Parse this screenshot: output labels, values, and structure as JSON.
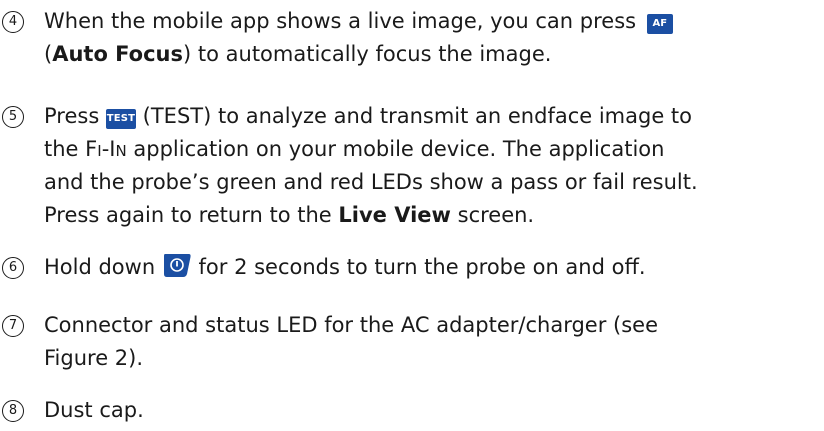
{
  "items": [
    {
      "number": "4",
      "line1_before": "When the mobile app shows a live image, you can press",
      "line1_icon": "AF",
      "line2_bold": "Auto Focus",
      "line2_open": "(",
      "line2_after": ") to automatically focus the image."
    },
    {
      "number": "5",
      "line1_before": "Press",
      "line1_icon": "TEST",
      "line1_after": "(TEST) to analyze and transmit an endface image to",
      "line2_before": "the",
      "line2_fi_F": "F",
      "line2_fi_I": "I",
      "line2_fi_dash": "-",
      "line2_in_I": "I",
      "line2_in_N": "N",
      "line2_after": "application on your mobile device. The application",
      "line3": "and the probe’s green and red LEDs show a pass or fail result.",
      "line4_before": "Press again to return to the",
      "line4_bold": "Live View",
      "line4_after": "screen."
    },
    {
      "number": "6",
      "line1_before": "Hold down",
      "line1_icon": "power-button",
      "line1_after": "for 2 seconds to turn the probe on and off."
    },
    {
      "number": "7",
      "line1": "Connector and status LED for the AC adapter/charger (see",
      "line2": "Figure 2)."
    },
    {
      "number": "8",
      "line1": "Dust cap."
    }
  ],
  "colors": {
    "button_blue": "#1b4fa3",
    "text": "#1a1a1a"
  }
}
